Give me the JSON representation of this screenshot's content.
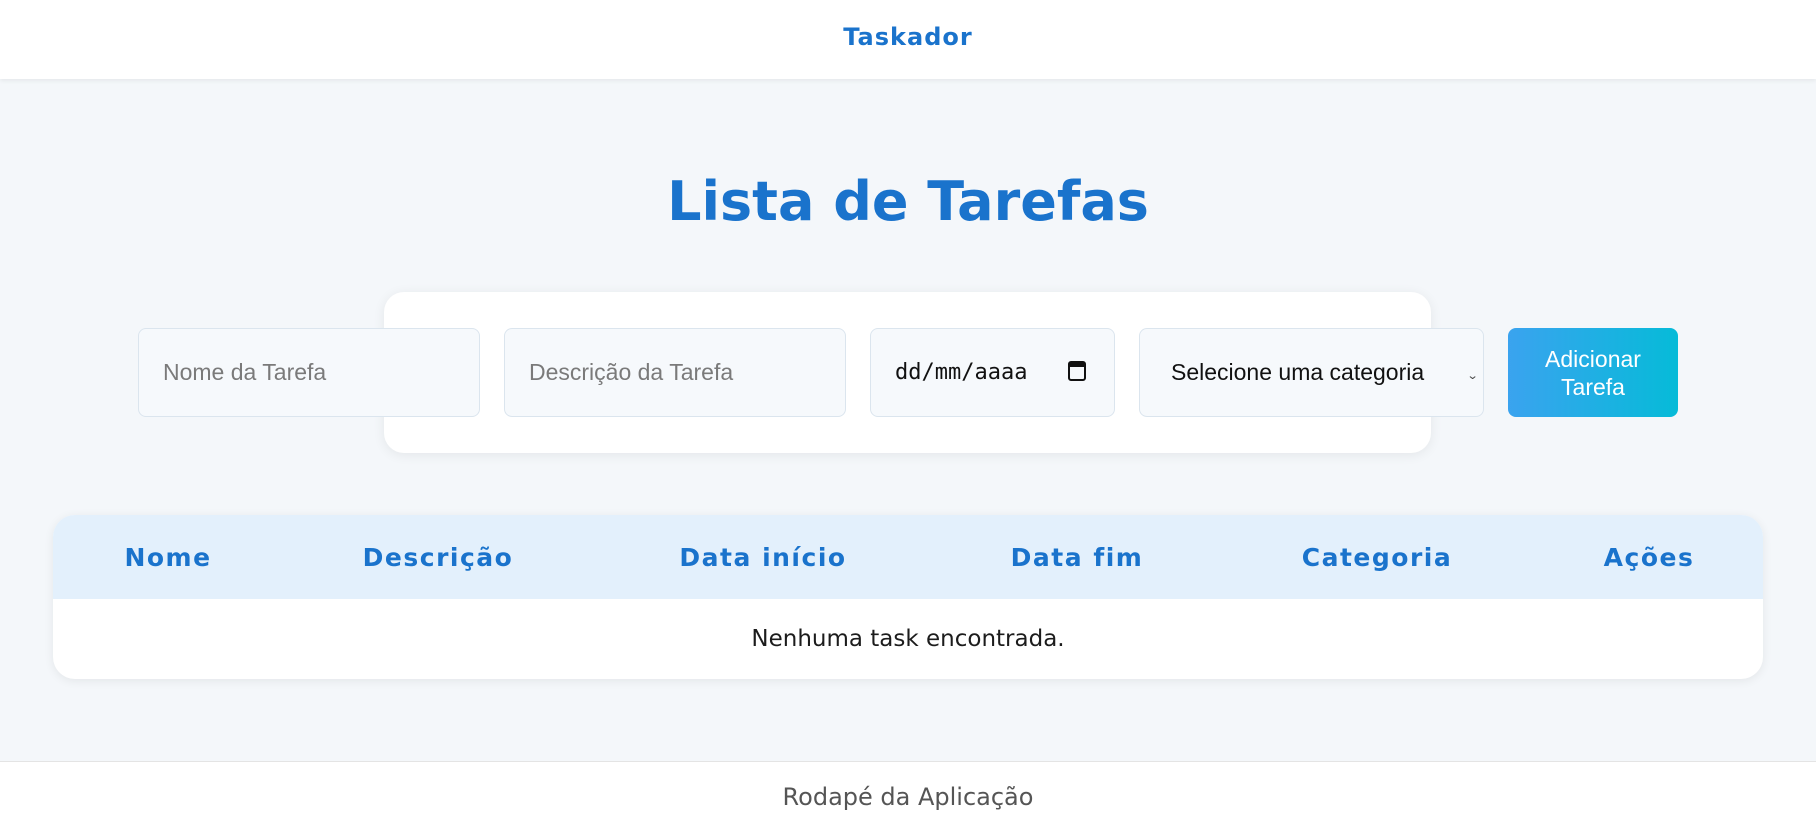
{
  "navbar": {
    "brand": "Taskador"
  },
  "page": {
    "title": "Lista de Tarefas"
  },
  "form": {
    "name_placeholder": "Nome da Tarefa",
    "description_placeholder": "Descrição da Tarefa",
    "date_placeholder": "dd/mm/aaaa",
    "category_selected": "Selecione uma categoria",
    "add_button": "Adicionar Tarefa"
  },
  "table": {
    "headers": [
      "Nome",
      "Descrição",
      "Data início",
      "Data fim",
      "Categoria",
      "Ações"
    ],
    "empty_message": "Nenhuma task encontrada."
  },
  "footer": {
    "text": "Rodapé da Aplicação"
  },
  "colors": {
    "accent": "#1a73cc",
    "background": "#f4f7fa",
    "table_header_bg": "#e3f0fc",
    "button_gradient_start": "#3aa3ef",
    "button_gradient_end": "#06bbd8"
  }
}
